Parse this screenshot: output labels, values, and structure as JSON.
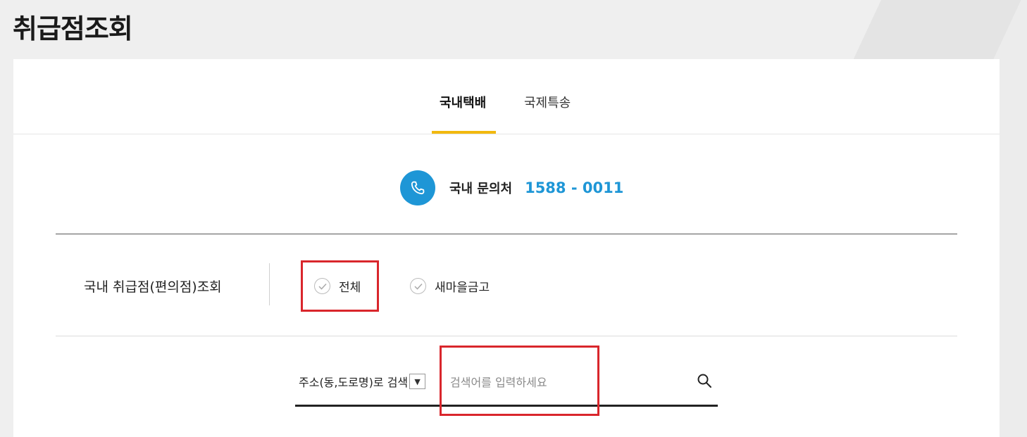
{
  "page": {
    "title": "취급점조회"
  },
  "tabs": [
    {
      "label": "국내택배",
      "active": true
    },
    {
      "label": "국제특송",
      "active": false
    }
  ],
  "contact": {
    "label": "국내 문의처",
    "number": "1588 - 0011"
  },
  "filter": {
    "label": "국내 취급점(편의점)조회",
    "options": [
      {
        "label": "전체",
        "icon": "check-circle-icon"
      },
      {
        "label": "새마을금고",
        "icon": "check-circle-icon"
      }
    ]
  },
  "search": {
    "type_label": "주소(동,도로명)로 검색",
    "placeholder": "검색어를 입력하세요",
    "value": ""
  },
  "colors": {
    "accent": "#1e96d6",
    "tab_underline": "#f2b90f",
    "highlight": "#d9262c"
  }
}
